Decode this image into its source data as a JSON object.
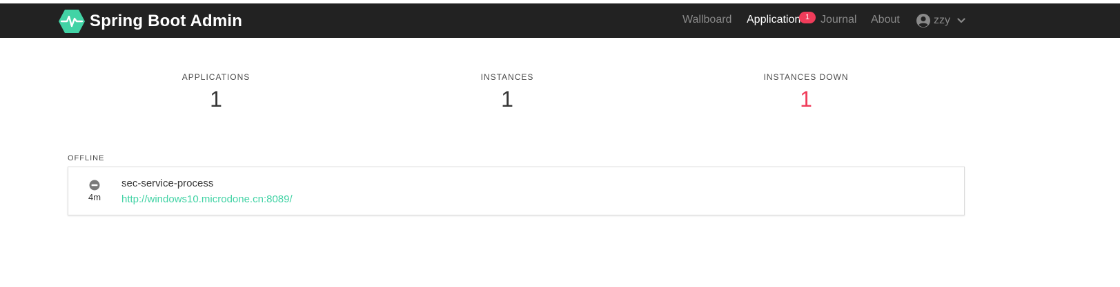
{
  "brand": {
    "title": "Spring Boot Admin",
    "logo_icon": "heartbeat-hexagon-icon",
    "accent_color": "#42d3a5"
  },
  "nav": {
    "items": [
      {
        "label": "Wallboard",
        "active": false
      },
      {
        "label": "Applications",
        "active": true
      },
      {
        "label": "Journal",
        "active": false
      },
      {
        "label": "About",
        "active": false
      }
    ],
    "applications_badge": "1",
    "badge_color": "#f03c5a",
    "user": {
      "name": "zzy",
      "icon": "user-circle-icon",
      "menu_icon": "chevron-down-icon"
    }
  },
  "stats": {
    "applications": {
      "label": "APPLICATIONS",
      "value": "1"
    },
    "instances": {
      "label": "INSTANCES",
      "value": "1"
    },
    "instances_down": {
      "label": "INSTANCES DOWN",
      "value": "1",
      "color": "#f03c5a"
    }
  },
  "groups": [
    {
      "status_label": "OFFLINE",
      "applications": [
        {
          "status_icon": "minus-circle-icon",
          "since": "4m",
          "name": "sec-service-process",
          "url": "http://windows10.microdone.cn:8089/"
        }
      ]
    }
  ]
}
